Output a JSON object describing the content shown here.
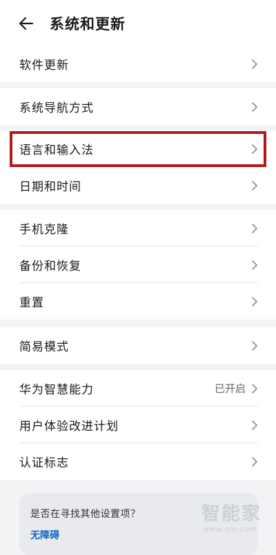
{
  "header": {
    "title": "系统和更新"
  },
  "groups": [
    {
      "items": [
        {
          "label": "软件更新",
          "value": ""
        }
      ]
    },
    {
      "items": [
        {
          "label": "系统导航方式",
          "value": ""
        }
      ]
    },
    {
      "items": [
        {
          "label": "语言和输入法",
          "value": ""
        },
        {
          "label": "日期和时间",
          "value": ""
        }
      ]
    },
    {
      "items": [
        {
          "label": "手机克隆",
          "value": ""
        },
        {
          "label": "备份和恢复",
          "value": ""
        },
        {
          "label": "重置",
          "value": ""
        }
      ]
    },
    {
      "items": [
        {
          "label": "简易模式",
          "value": ""
        }
      ]
    },
    {
      "items": [
        {
          "label": "华为智慧能力",
          "value": "已开启"
        },
        {
          "label": "用户体验改进计划",
          "value": ""
        },
        {
          "label": "认证标志",
          "value": ""
        }
      ]
    }
  ],
  "suggestion": {
    "question": "是否在寻找其他设置项？",
    "link": "无障碍"
  },
  "watermark": {
    "brand": "智能家",
    "url": "www.znj.com"
  },
  "colors": {
    "highlight": "#b3171a",
    "link": "#1565c0",
    "background": "#f1f3f5"
  },
  "icons": {
    "back": "arrow-left-icon",
    "row": "chevron-right-icon"
  }
}
